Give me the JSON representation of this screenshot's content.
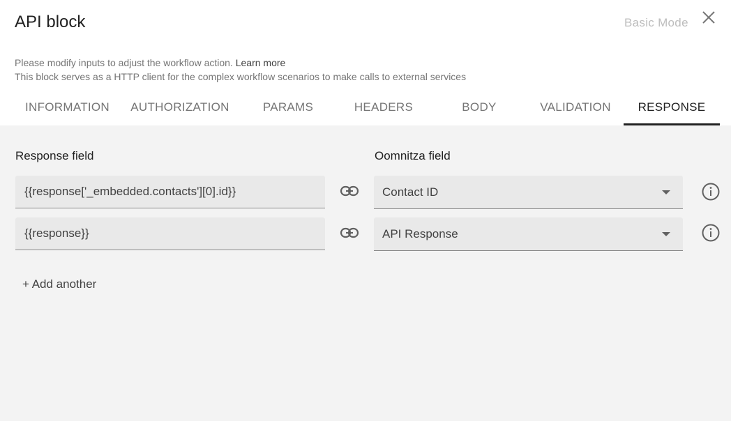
{
  "header": {
    "title": "API block",
    "mode_toggle": "Basic Mode",
    "description_line1": "Please modify inputs to adjust the workflow action.",
    "learn_more": "Learn more",
    "description_line2": "This block serves as a HTTP client for the complex workflow scenarios to make calls to external services"
  },
  "tabs": [
    "INFORMATION",
    "AUTHORIZATION",
    "PARAMS",
    "HEADERS",
    "BODY",
    "VALIDATION",
    "RESPONSE"
  ],
  "active_tab": "RESPONSE",
  "response": {
    "response_field_label": "Response field",
    "oomnitza_field_label": "Oomnitza field",
    "rows": [
      {
        "response_value": "{{response['_embedded.contacts'][0].id}}",
        "oomnitza_value": "Contact ID"
      },
      {
        "response_value": "{{response}}",
        "oomnitza_value": "API Response"
      }
    ],
    "add_another": "+ Add another"
  },
  "colors": {
    "accent": "#212121",
    "panel_bg": "#f3f3f3",
    "field_bg": "#e9e9e9",
    "muted_text": "#757575"
  },
  "icons": [
    "close-icon",
    "link-icon",
    "info-icon",
    "dropdown-arrow-icon"
  ]
}
